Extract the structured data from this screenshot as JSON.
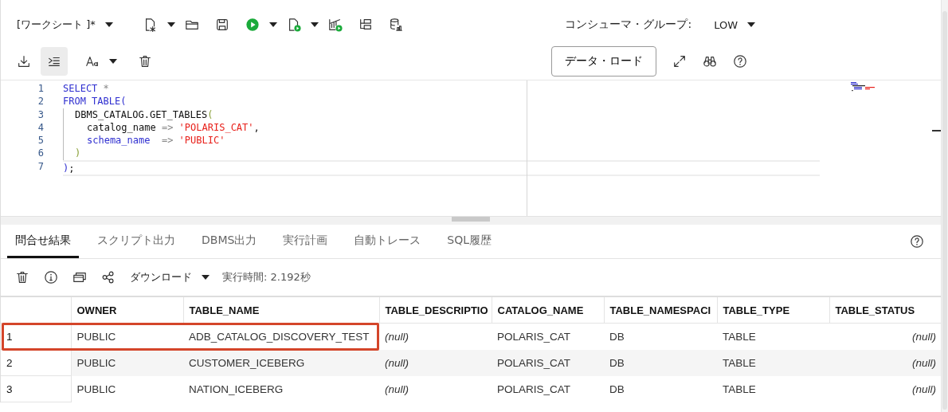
{
  "toolbar": {
    "worksheet": "[ワークシート ]*",
    "indent_toggle_on": true,
    "consumer_group_label": "コンシューマ・グループ:",
    "consumer_group": "LOW",
    "data_load": "データ・ロード"
  },
  "editor": {
    "lines": [
      {
        "number": "1",
        "tokens": [
          {
            "kind": "kw",
            "text": "SELECT"
          },
          {
            "kind": "op",
            "text": " *"
          }
        ]
      },
      {
        "number": "2",
        "tokens": [
          {
            "kind": "kw",
            "text": "FROM TABLE("
          }
        ],
        "children": [
          {
            "number": "3",
            "tokens": [
              {
                "kind": "ident",
                "text": "DBMS_CATALOG.GET_TABLES"
              },
              {
                "kind": "paren",
                "text": "("
              }
            ],
            "children": [
              {
                "number": "4",
                "tokens": [
                  {
                    "kind": "ident",
                    "text": "catalog_name"
                  },
                  {
                    "kind": "op",
                    "text": " => "
                  },
                  {
                    "kind": "str",
                    "text": "'POLARIS_CAT'"
                  },
                  {
                    "kind": "ident",
                    "text": ","
                  }
                ]
              },
              {
                "number": "5",
                "tokens": [
                  {
                    "kind": "kw",
                    "text": "schema_name"
                  },
                  {
                    "kind": "op",
                    "text": "  => "
                  },
                  {
                    "kind": "str",
                    "text": "'PUBLIC'"
                  }
                ]
              }
            ]
          },
          {
            "number": "6",
            "tokens": [
              {
                "kind": "paren",
                "text": ")"
              }
            ]
          }
        ]
      },
      {
        "number": "7",
        "tokens": [
          {
            "kind": "kw",
            "text": ")"
          },
          {
            "kind": "ident",
            "text": ";"
          }
        ]
      }
    ]
  },
  "results": {
    "tabs": [
      {
        "label": "問合せ結果",
        "selected": true
      },
      {
        "label": "スクリプト出力",
        "selected": false
      },
      {
        "label": "DBMS出力",
        "selected": false
      },
      {
        "label": "実行計画",
        "selected": false
      },
      {
        "label": "自動トレース",
        "selected": false
      },
      {
        "label": "SQL履歴",
        "selected": false
      }
    ],
    "download": "ダウンロード",
    "elapsed": "実行時間: 2.192秒",
    "table": {
      "columns": [
        "OWNER",
        "TABLE_NAME",
        "TABLE_DESCRIPTIO",
        "CATALOG_NAME",
        "TABLE_NAMESPACI",
        "TABLE_TYPE",
        "TABLE_STATUS"
      ],
      "rows": [
        {
          "number": "1",
          "highlighted": true,
          "cells": [
            {
              "text": "PUBLIC",
              "null": false
            },
            {
              "text": "ADB_CATALOG_DISCOVERY_TEST",
              "null": false
            },
            {
              "text": "(null)",
              "null": true
            },
            {
              "text": "POLARIS_CAT",
              "null": false
            },
            {
              "text": "DB",
              "null": false
            },
            {
              "text": "TABLE",
              "null": false
            },
            {
              "text": "(null)",
              "null": true
            }
          ]
        },
        {
          "number": "2",
          "highlighted": false,
          "cells": [
            {
              "text": "PUBLIC",
              "null": false
            },
            {
              "text": "CUSTOMER_ICEBERG",
              "null": false
            },
            {
              "text": "(null)",
              "null": true
            },
            {
              "text": "POLARIS_CAT",
              "null": false
            },
            {
              "text": "DB",
              "null": false
            },
            {
              "text": "TABLE",
              "null": false
            },
            {
              "text": "(null)",
              "null": true
            }
          ]
        },
        {
          "number": "3",
          "highlighted": false,
          "cells": [
            {
              "text": "PUBLIC",
              "null": false
            },
            {
              "text": "NATION_ICEBERG",
              "null": false
            },
            {
              "text": "(null)",
              "null": true
            },
            {
              "text": "POLARIS_CAT",
              "null": false
            },
            {
              "text": "DB",
              "null": false
            },
            {
              "text": "TABLE",
              "null": false
            },
            {
              "text": "(null)",
              "null": true
            }
          ]
        }
      ]
    }
  }
}
